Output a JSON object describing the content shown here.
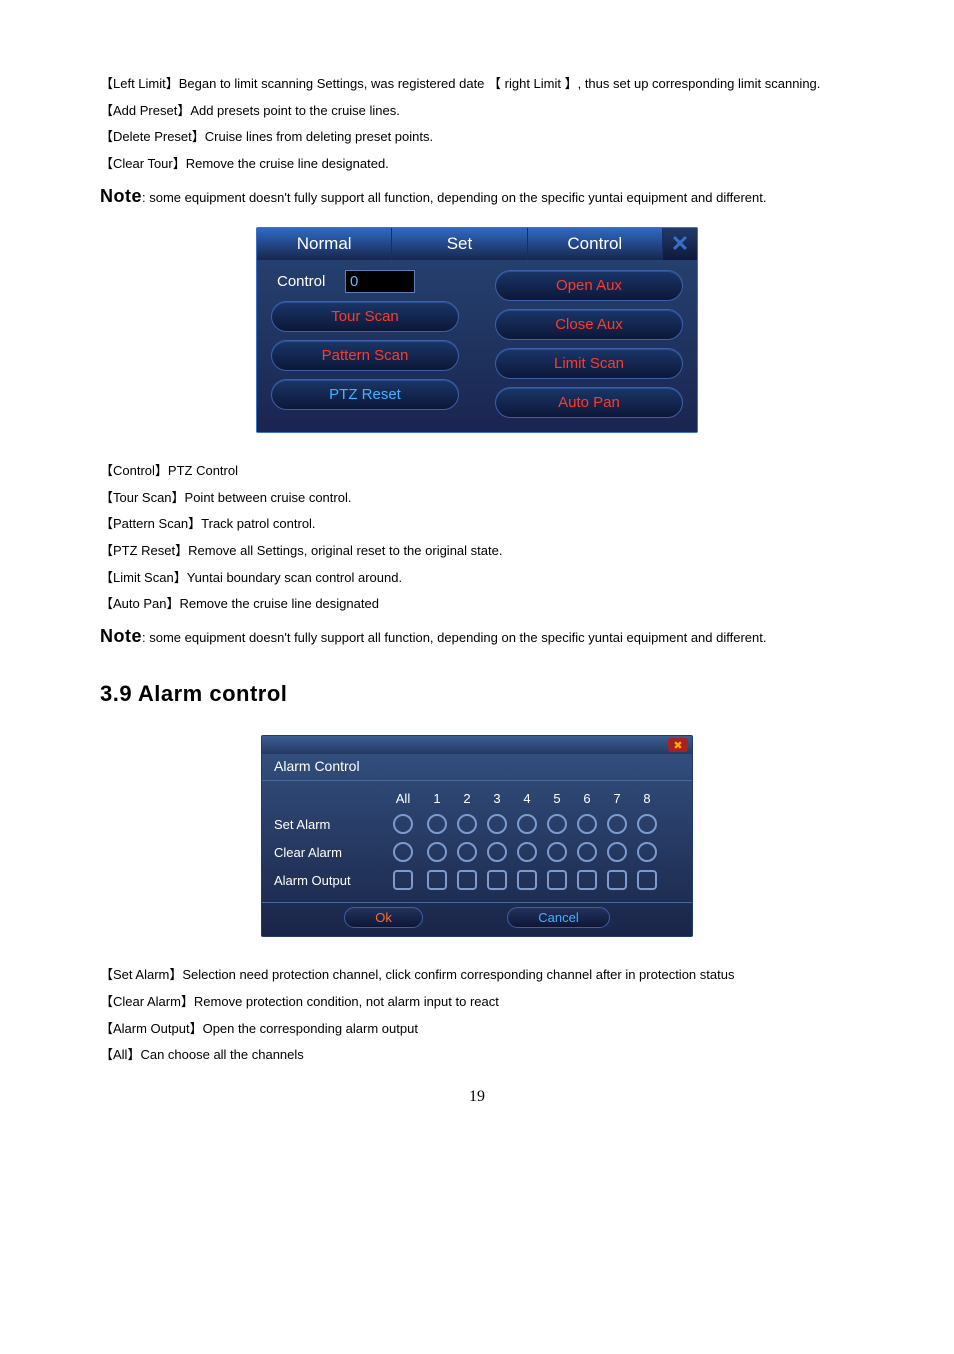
{
  "text": {
    "p1": "【Left Limit】Began to limit scanning Settings, was registered date  【 right Limit 】, thus set up corresponding limit scanning.",
    "p2": "【Add Preset】Add presets point to the cruise lines.",
    "p3": "【Delete Preset】Cruise lines from deleting preset points.",
    "p4": "【Clear Tour】Remove the cruise line designated.",
    "note1_label": "Note",
    "note1_body": ": some equipment doesn't fully support all function, depending on the specific yuntai equipment and different.",
    "p5": "【Control】PTZ Control",
    "p6": "【Tour Scan】Point between cruise control.",
    "p7": "【Pattern Scan】Track patrol control.",
    "p8": "【PTZ Reset】Remove all Settings, original reset to the original state.",
    "p9": "【Limit Scan】Yuntai boundary scan control around.",
    "p10": "【Auto Pan】Remove the cruise line designated",
    "note2_label": "Note",
    "note2_body": ": some equipment doesn't fully support all function, depending on the specific yuntai equipment and different.",
    "section": "3.9 Alarm control",
    "p11": "【Set Alarm】Selection need protection channel, click confirm corresponding channel after in protection status",
    "p12": "【Clear Alarm】Remove protection condition, not alarm input to react",
    "p13": "【Alarm Output】Open the corresponding alarm output",
    "p14": "【All】Can choose all the channels",
    "page_num": "19"
  },
  "ptz": {
    "tab1": "Normal",
    "tab2": "Set",
    "tab3": "Control",
    "close": "✕",
    "control_label": "Control",
    "control_value": "0",
    "btn_open_aux": "Open Aux",
    "btn_tour_scan": "Tour Scan",
    "btn_close_aux": "Close Aux",
    "btn_pattern_scan": "Pattern Scan",
    "btn_limit_scan": "Limit Scan",
    "btn_ptz_reset": "PTZ Reset",
    "btn_auto_pan": "Auto Pan"
  },
  "alarm": {
    "title": "Alarm Control",
    "header_all": "All",
    "cols": [
      "1",
      "2",
      "3",
      "4",
      "5",
      "6",
      "7",
      "8"
    ],
    "row_set": "Set Alarm",
    "row_clear": "Clear Alarm",
    "row_out": "Alarm Output",
    "ok": "Ok",
    "cancel": "Cancel"
  }
}
